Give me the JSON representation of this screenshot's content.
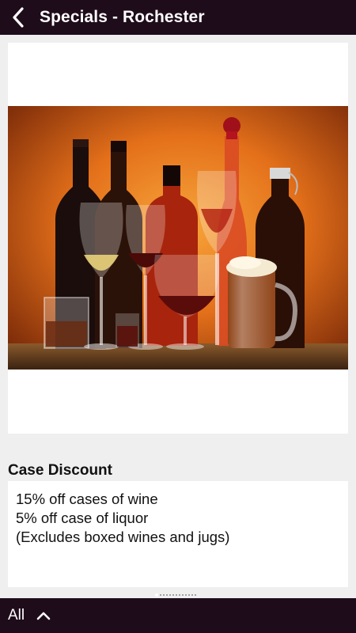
{
  "header": {
    "title": "Specials - Rochester",
    "back_icon": "chevron-left-icon"
  },
  "special": {
    "image_alt": "Assorted wine, liquor and beer bottles and glasses on an orange background",
    "heading": "Case Discount",
    "description_lines": [
      "15% off cases of wine",
      "5% off case of liquor",
      "(Excludes boxed wines and jugs)"
    ]
  },
  "pager": {
    "total": 13,
    "active_index": 0
  },
  "footer": {
    "all_label": "All",
    "expand_icon": "chevron-up-icon"
  },
  "colors": {
    "bar_background": "#1f0c1b",
    "page_background": "#efefef",
    "card_background": "#ffffff"
  }
}
